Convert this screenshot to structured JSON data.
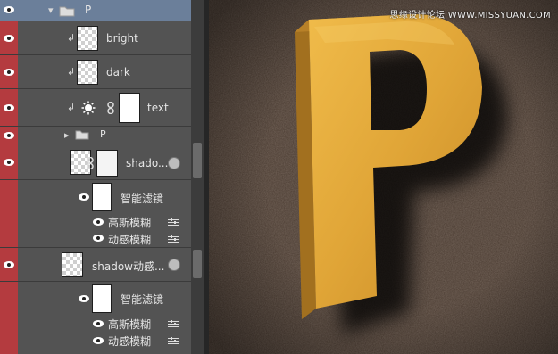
{
  "layers": {
    "group_top": {
      "label": "P"
    },
    "bright": {
      "label": "bright"
    },
    "dark": {
      "label": "dark"
    },
    "text": {
      "label": "text"
    },
    "group_p": {
      "label": "P"
    },
    "shadow1": {
      "label": "shado...",
      "filters_title": "智能滤镜",
      "filter1": "高斯模糊",
      "filter2": "动感模糊"
    },
    "shadow2": {
      "label": "shadow动感...",
      "filters_title": "智能滤镜",
      "filter1": "高斯模糊",
      "filter2": "动感模糊"
    }
  },
  "canvas": {
    "letter": "P",
    "watermark": "思缘设计论坛  WWW.MISSYUAN.COM",
    "colors": {
      "background": "#4a3b31",
      "letter_face": "#e0a537",
      "letter_side": "#a2701f"
    }
  },
  "colors": {
    "panel_bg": "#535353",
    "visibility_column": "#b43b3f"
  }
}
